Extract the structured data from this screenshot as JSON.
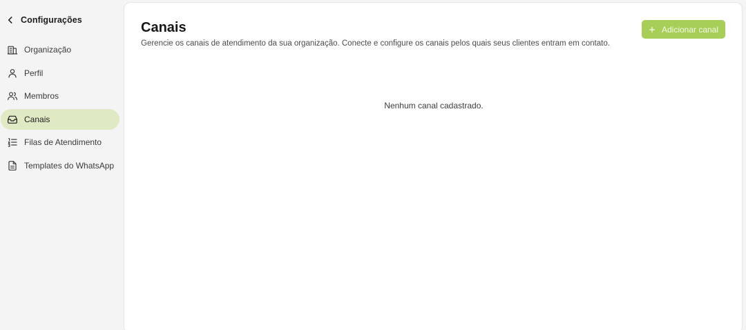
{
  "sidebar": {
    "back_label": "Configurações",
    "items": [
      {
        "label": "Organização",
        "icon": "building-icon",
        "active": false
      },
      {
        "label": "Perfil",
        "icon": "user-icon",
        "active": false
      },
      {
        "label": "Membros",
        "icon": "users-icon",
        "active": false
      },
      {
        "label": "Canais",
        "icon": "inbox-icon",
        "active": true
      },
      {
        "label": "Filas de Atendimento",
        "icon": "list-ordered-icon",
        "active": false
      },
      {
        "label": "Templates do WhatsApp",
        "icon": "file-text-icon",
        "active": false
      }
    ]
  },
  "main": {
    "title": "Canais",
    "subtitle": "Gerencie os canais de atendimento da sua organização. Conecte e configure os canais pelos quais seus clientes entram em contato.",
    "add_button_label": "Adicionar canal",
    "empty_message": "Nenhum canal cadastrado."
  },
  "colors": {
    "accent": "#a7cf57",
    "active_nav_bg": "#dfe9c4",
    "page_bg": "#f4f4f4",
    "panel_bg": "#ffffff"
  }
}
